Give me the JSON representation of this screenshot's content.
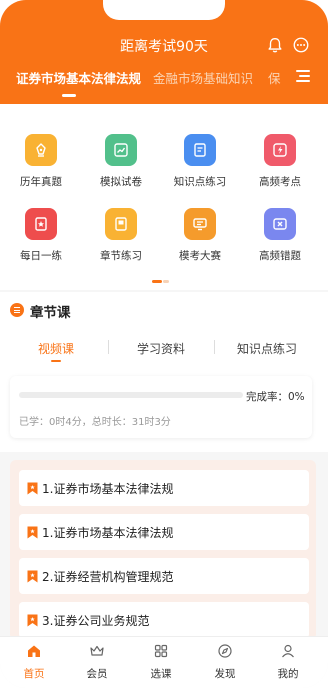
{
  "header": {
    "exam_countdown": "距离考试90天",
    "tabs": [
      {
        "label": "证券市场基本法律法规",
        "active": true
      },
      {
        "label": "金融市场基础知识",
        "active": false
      },
      {
        "label": "保",
        "active": false
      }
    ]
  },
  "grid": [
    {
      "label": "历年真题",
      "icon": "pen-nib-icon",
      "color": "#f9b233"
    },
    {
      "label": "模拟试卷",
      "icon": "trend-chart-icon",
      "color": "#52c08b"
    },
    {
      "label": "知识点练习",
      "icon": "document-edit-icon",
      "color": "#4a8ef0"
    },
    {
      "label": "高频考点",
      "icon": "lightning-icon",
      "color": "#f05a6a"
    },
    {
      "label": "每日一练",
      "icon": "star-bookmark-icon",
      "color": "#ee4d4d"
    },
    {
      "label": "章节练习",
      "icon": "book-icon",
      "color": "#f9b233"
    },
    {
      "label": "模考大赛",
      "icon": "monitor-icon",
      "color": "#f59b2c"
    },
    {
      "label": "高频错题",
      "icon": "error-x-icon",
      "color": "#7a87ef"
    }
  ],
  "chapter": {
    "title": "章节课",
    "tabs": [
      {
        "label": "视频课",
        "active": true
      },
      {
        "label": "学习资料",
        "active": false
      },
      {
        "label": "知识点练习",
        "active": false
      }
    ],
    "progress": {
      "completion_label": "完成率：",
      "completion_value": "0%",
      "completion_fraction": 0,
      "learned_text": "已学：0时4分，总时长：31时3分"
    }
  },
  "chapter_list": [
    "1.证券市场基本法律法规",
    "1.证券市场基本法律法规",
    "2.证券经营机构管理规范",
    "3.证券公司业务规范"
  ],
  "nav": [
    {
      "label": "首页",
      "icon": "home-icon",
      "active": true
    },
    {
      "label": "会员",
      "icon": "crown-icon",
      "active": false
    },
    {
      "label": "选课",
      "icon": "grid-icon",
      "active": false
    },
    {
      "label": "发现",
      "icon": "compass-icon",
      "active": false
    },
    {
      "label": "我的",
      "icon": "user-icon",
      "active": false
    }
  ],
  "colors": {
    "brand": "#f97316",
    "inactive_tab": "#fbd4b4",
    "list_background": "#fbeee8"
  }
}
